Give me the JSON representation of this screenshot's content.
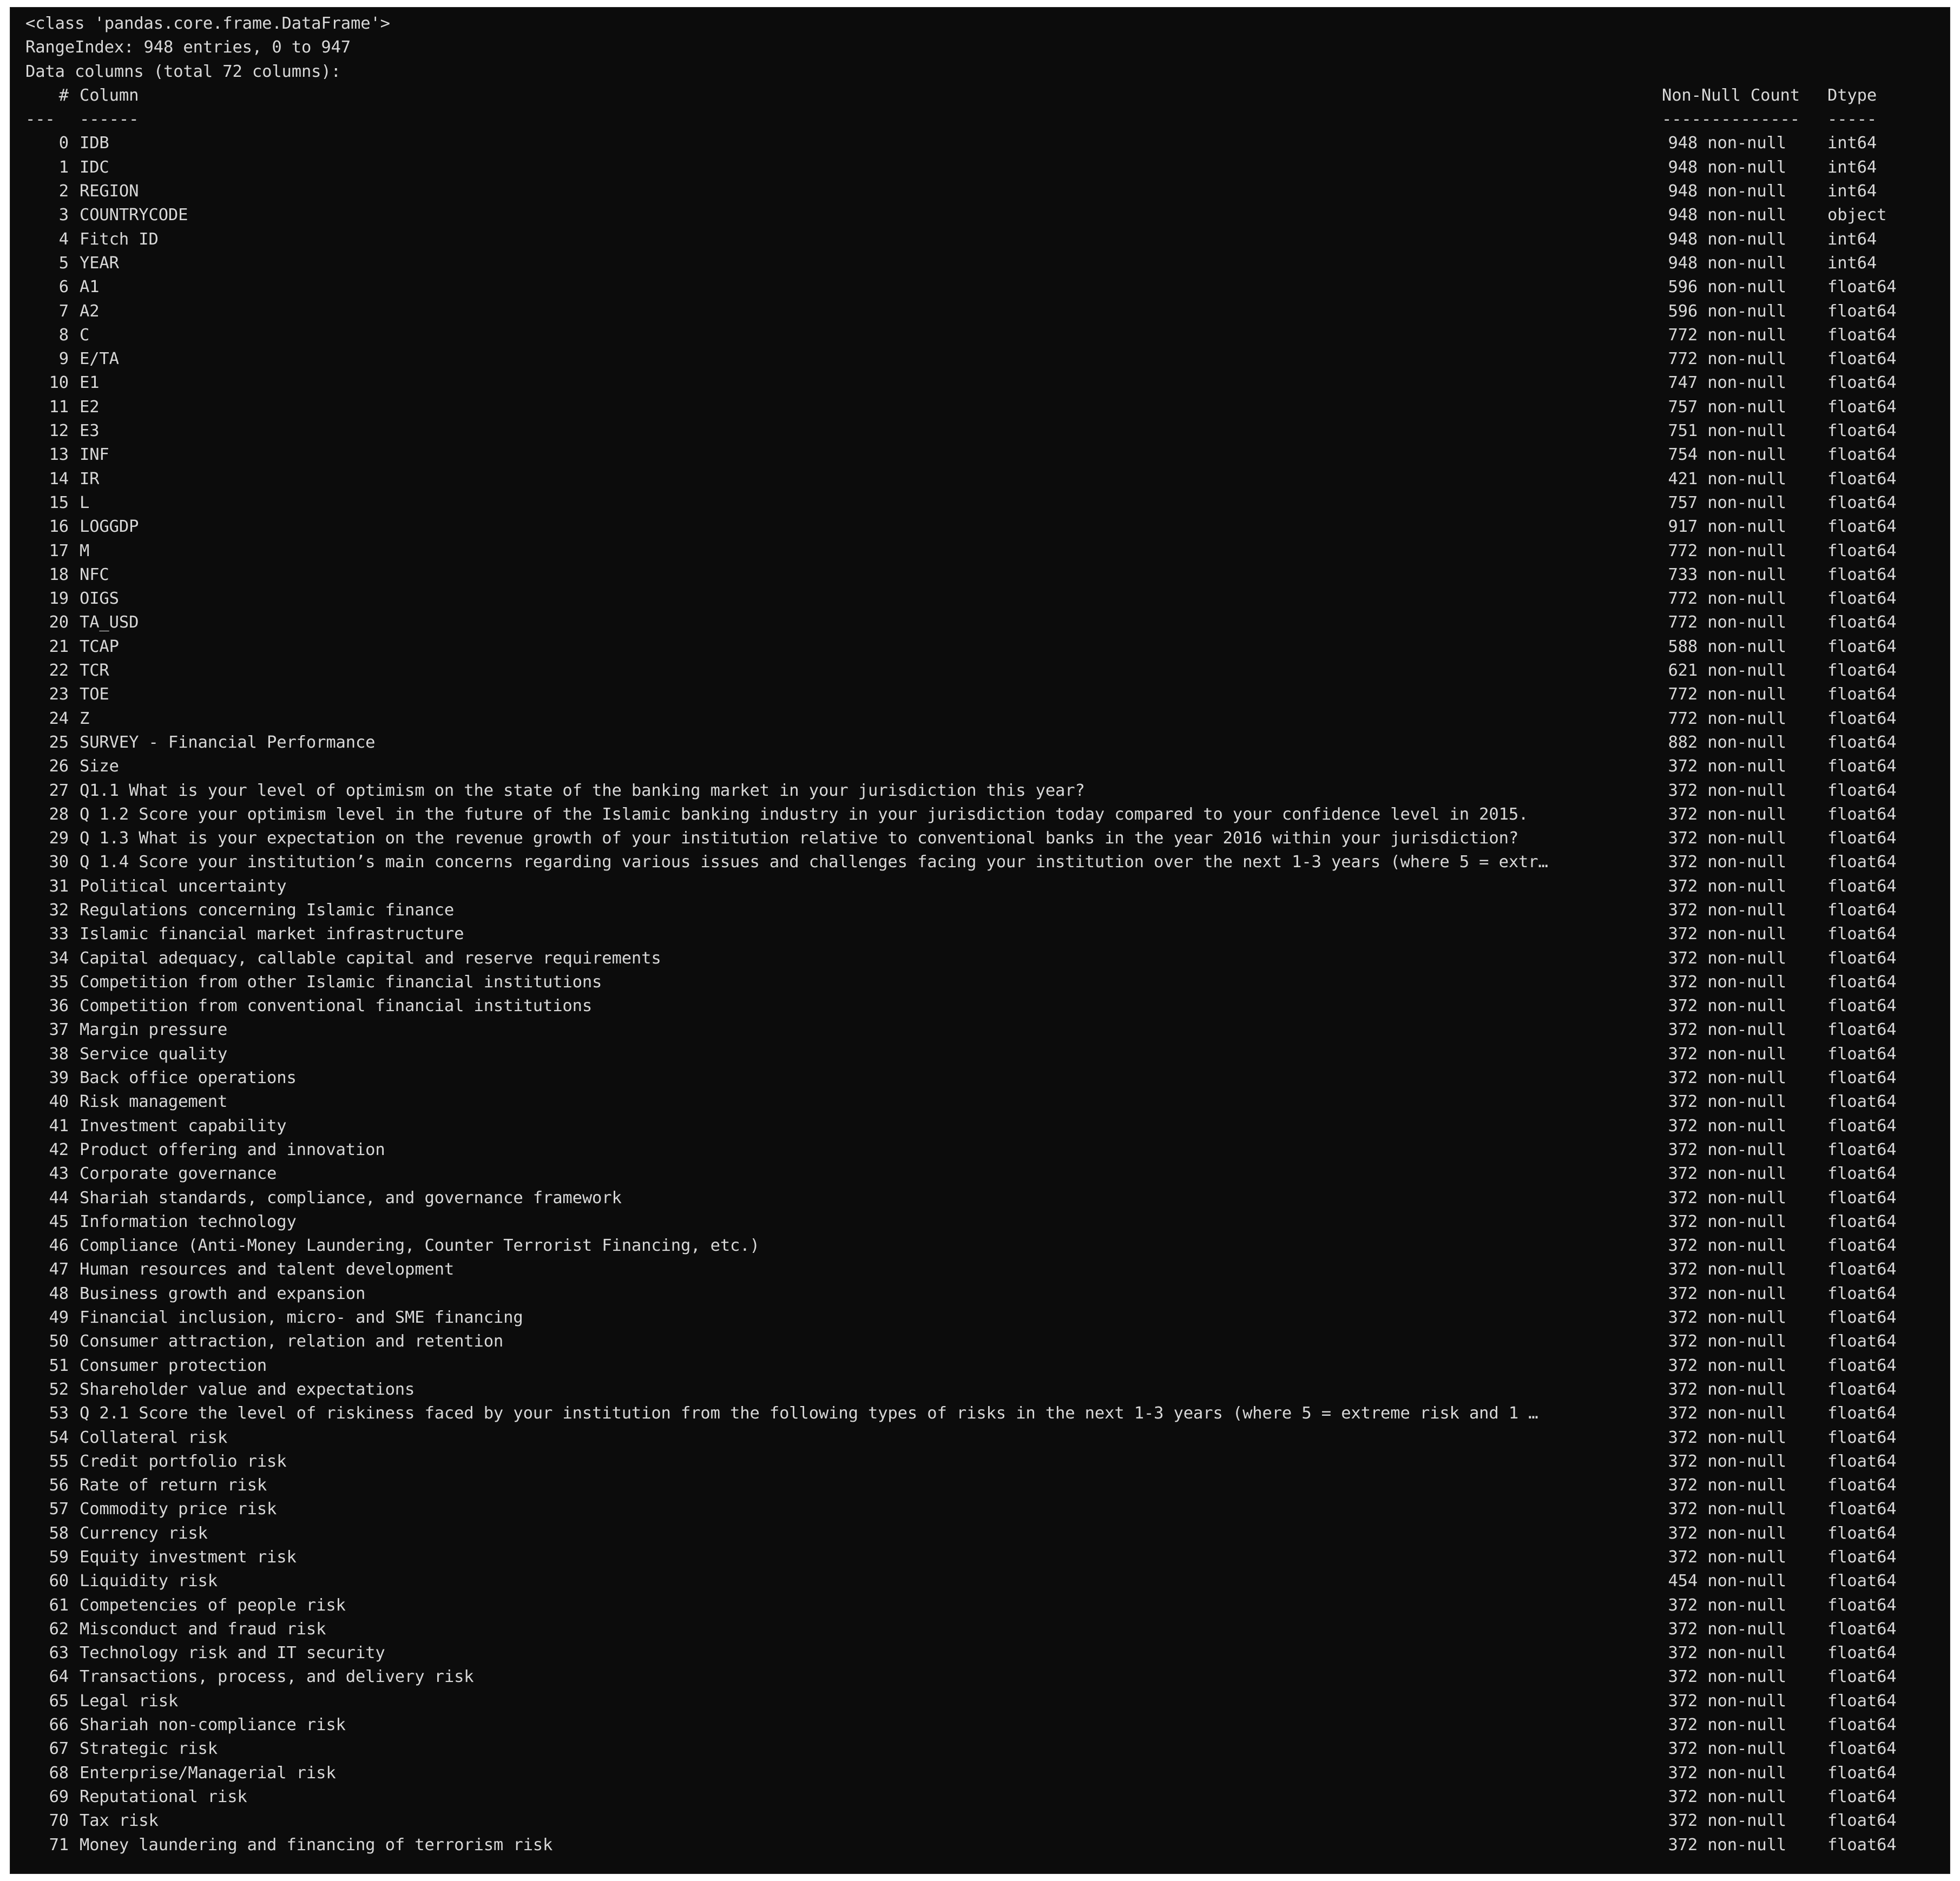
{
  "terminal": {
    "header_lines": [
      "<class 'pandas.core.frame.DataFrame'>",
      "RangeIndex: 948 entries, 0 to 947",
      "Data columns (total 72 columns):"
    ],
    "column_headers": {
      "index": "#",
      "column": "Column",
      "count": "Non-Null Count",
      "dtype": "Dtype"
    },
    "separator": {
      "index": "---",
      "column": "------",
      "count": "--------------",
      "dtype": "-----"
    },
    "rows": [
      {
        "idx": "0",
        "name": "IDB",
        "count": "948 non-null",
        "dtype": "int64"
      },
      {
        "idx": "1",
        "name": "IDC",
        "count": "948 non-null",
        "dtype": "int64"
      },
      {
        "idx": "2",
        "name": "REGION",
        "count": "948 non-null",
        "dtype": "int64"
      },
      {
        "idx": "3",
        "name": "COUNTRYCODE",
        "count": "948 non-null",
        "dtype": "object"
      },
      {
        "idx": "4",
        "name": "Fitch ID",
        "count": "948 non-null",
        "dtype": "int64"
      },
      {
        "idx": "5",
        "name": "YEAR",
        "count": "948 non-null",
        "dtype": "int64"
      },
      {
        "idx": "6",
        "name": "A1",
        "count": "596 non-null",
        "dtype": "float64"
      },
      {
        "idx": "7",
        "name": "A2",
        "count": "596 non-null",
        "dtype": "float64"
      },
      {
        "idx": "8",
        "name": "C",
        "count": "772 non-null",
        "dtype": "float64"
      },
      {
        "idx": "9",
        "name": "E/TA",
        "count": "772 non-null",
        "dtype": "float64"
      },
      {
        "idx": "10",
        "name": "E1",
        "count": "747 non-null",
        "dtype": "float64"
      },
      {
        "idx": "11",
        "name": "E2",
        "count": "757 non-null",
        "dtype": "float64"
      },
      {
        "idx": "12",
        "name": "E3",
        "count": "751 non-null",
        "dtype": "float64"
      },
      {
        "idx": "13",
        "name": "INF",
        "count": "754 non-null",
        "dtype": "float64"
      },
      {
        "idx": "14",
        "name": "IR",
        "count": "421 non-null",
        "dtype": "float64"
      },
      {
        "idx": "15",
        "name": "L",
        "count": "757 non-null",
        "dtype": "float64"
      },
      {
        "idx": "16",
        "name": "LOGGDP",
        "count": "917 non-null",
        "dtype": "float64"
      },
      {
        "idx": "17",
        "name": "M",
        "count": "772 non-null",
        "dtype": "float64"
      },
      {
        "idx": "18",
        "name": "NFC",
        "count": "733 non-null",
        "dtype": "float64"
      },
      {
        "idx": "19",
        "name": "OIGS",
        "count": "772 non-null",
        "dtype": "float64"
      },
      {
        "idx": "20",
        "name": "TA_USD",
        "count": "772 non-null",
        "dtype": "float64"
      },
      {
        "idx": "21",
        "name": "TCAP",
        "count": "588 non-null",
        "dtype": "float64"
      },
      {
        "idx": "22",
        "name": "TCR",
        "count": "621 non-null",
        "dtype": "float64"
      },
      {
        "idx": "23",
        "name": "TOE",
        "count": "772 non-null",
        "dtype": "float64"
      },
      {
        "idx": "24",
        "name": "Z",
        "count": "772 non-null",
        "dtype": "float64"
      },
      {
        "idx": "25",
        "name": "SURVEY - Financial Performance",
        "count": "882 non-null",
        "dtype": "float64"
      },
      {
        "idx": "26",
        "name": "Size",
        "count": "372 non-null",
        "dtype": "float64"
      },
      {
        "idx": "27",
        "name": "Q1.1 What is your level of optimism on the state of the banking market in your jurisdiction this year?",
        "count": "372 non-null",
        "dtype": "float64"
      },
      {
        "idx": "28",
        "name": "Q 1.2 Score your optimism level in the future of the Islamic banking industry in your jurisdiction today compared to your confidence level in 2015.",
        "count": "372 non-null",
        "dtype": "float64"
      },
      {
        "idx": "29",
        "name": "Q 1.3 What is your expectation on the revenue growth of your institution relative to conventional banks in the year 2016 within your jurisdiction?",
        "count": "372 non-null",
        "dtype": "float64"
      },
      {
        "idx": "30",
        "name": "Q 1.4 Score your institution’s main concerns regarding various issues and challenges facing your institution over the next 1-3 years (where 5 = extr…",
        "count": "372 non-null",
        "dtype": "float64"
      },
      {
        "idx": "31",
        "name": "Political uncertainty",
        "count": "372 non-null",
        "dtype": "float64"
      },
      {
        "idx": "32",
        "name": "Regulations concerning Islamic finance",
        "count": "372 non-null",
        "dtype": "float64"
      },
      {
        "idx": "33",
        "name": "Islamic financial market infrastructure",
        "count": "372 non-null",
        "dtype": "float64"
      },
      {
        "idx": "34",
        "name": "Capital adequacy, callable capital and reserve requirements",
        "count": "372 non-null",
        "dtype": "float64"
      },
      {
        "idx": "35",
        "name": "Competition from other Islamic financial institutions",
        "count": "372 non-null",
        "dtype": "float64"
      },
      {
        "idx": "36",
        "name": "Competition from conventional financial institutions",
        "count": "372 non-null",
        "dtype": "float64"
      },
      {
        "idx": "37",
        "name": "Margin pressure",
        "count": "372 non-null",
        "dtype": "float64"
      },
      {
        "idx": "38",
        "name": "Service quality",
        "count": "372 non-null",
        "dtype": "float64"
      },
      {
        "idx": "39",
        "name": "Back office operations",
        "count": "372 non-null",
        "dtype": "float64"
      },
      {
        "idx": "40",
        "name": "Risk management",
        "count": "372 non-null",
        "dtype": "float64"
      },
      {
        "idx": "41",
        "name": "Investment capability",
        "count": "372 non-null",
        "dtype": "float64"
      },
      {
        "idx": "42",
        "name": "Product offering and innovation",
        "count": "372 non-null",
        "dtype": "float64"
      },
      {
        "idx": "43",
        "name": "Corporate governance",
        "count": "372 non-null",
        "dtype": "float64"
      },
      {
        "idx": "44",
        "name": "Shariah standards, compliance, and governance framework",
        "count": "372 non-null",
        "dtype": "float64"
      },
      {
        "idx": "45",
        "name": "Information technology",
        "count": "372 non-null",
        "dtype": "float64"
      },
      {
        "idx": "46",
        "name": "Compliance (Anti-Money Laundering, Counter Terrorist Financing, etc.)",
        "count": "372 non-null",
        "dtype": "float64"
      },
      {
        "idx": "47",
        "name": "Human resources and talent development",
        "count": "372 non-null",
        "dtype": "float64"
      },
      {
        "idx": "48",
        "name": "Business growth and expansion",
        "count": "372 non-null",
        "dtype": "float64"
      },
      {
        "idx": "49",
        "name": "Financial inclusion, micro- and SME financing",
        "count": "372 non-null",
        "dtype": "float64"
      },
      {
        "idx": "50",
        "name": "Consumer attraction, relation and retention",
        "count": "372 non-null",
        "dtype": "float64"
      },
      {
        "idx": "51",
        "name": "Consumer protection",
        "count": "372 non-null",
        "dtype": "float64"
      },
      {
        "idx": "52",
        "name": "Shareholder value and expectations",
        "count": "372 non-null",
        "dtype": "float64"
      },
      {
        "idx": "53",
        "name": "Q 2.1 Score the level of riskiness faced by your institution from the following types of risks in the next 1-3 years (where 5 = extreme risk and 1 …",
        "count": "372 non-null",
        "dtype": "float64"
      },
      {
        "idx": "54",
        "name": "Collateral risk",
        "count": "372 non-null",
        "dtype": "float64"
      },
      {
        "idx": "55",
        "name": "Credit portfolio risk",
        "count": "372 non-null",
        "dtype": "float64"
      },
      {
        "idx": "56",
        "name": "Rate of return risk",
        "count": "372 non-null",
        "dtype": "float64"
      },
      {
        "idx": "57",
        "name": "Commodity price risk",
        "count": "372 non-null",
        "dtype": "float64"
      },
      {
        "idx": "58",
        "name": "Currency risk",
        "count": "372 non-null",
        "dtype": "float64"
      },
      {
        "idx": "59",
        "name": "Equity investment risk",
        "count": "372 non-null",
        "dtype": "float64"
      },
      {
        "idx": "60",
        "name": "Liquidity risk",
        "count": "454 non-null",
        "dtype": "float64"
      },
      {
        "idx": "61",
        "name": "Competencies of people risk",
        "count": "372 non-null",
        "dtype": "float64"
      },
      {
        "idx": "62",
        "name": "Misconduct and fraud risk",
        "count": "372 non-null",
        "dtype": "float64"
      },
      {
        "idx": "63",
        "name": "Technology risk and IT security",
        "count": "372 non-null",
        "dtype": "float64"
      },
      {
        "idx": "64",
        "name": "Transactions, process, and delivery risk",
        "count": "372 non-null",
        "dtype": "float64"
      },
      {
        "idx": "65",
        "name": "Legal risk",
        "count": "372 non-null",
        "dtype": "float64"
      },
      {
        "idx": "66",
        "name": "Shariah non-compliance risk",
        "count": "372 non-null",
        "dtype": "float64"
      },
      {
        "idx": "67",
        "name": "Strategic risk",
        "count": "372 non-null",
        "dtype": "float64"
      },
      {
        "idx": "68",
        "name": "Enterprise/Managerial risk",
        "count": "372 non-null",
        "dtype": "float64"
      },
      {
        "idx": "69",
        "name": "Reputational risk",
        "count": "372 non-null",
        "dtype": "float64"
      },
      {
        "idx": "70",
        "name": "Tax risk",
        "count": "372 non-null",
        "dtype": "float64"
      },
      {
        "idx": "71",
        "name": "Money laundering and financing of terrorism risk",
        "count": "372 non-null",
        "dtype": "float64"
      }
    ]
  }
}
